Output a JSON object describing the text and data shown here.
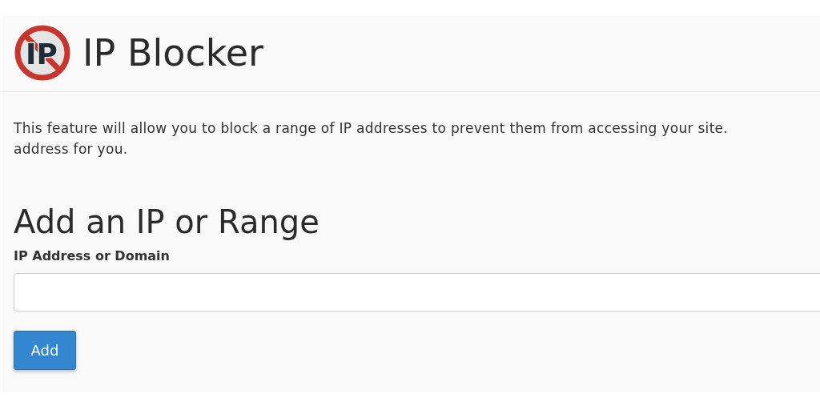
{
  "header": {
    "icon_text": "IP",
    "title": "IP Blocker"
  },
  "description": [
    "This feature will allow you to block a range of IP addresses to prevent them from accessing your site.",
    "address for you."
  ],
  "section": {
    "heading": "Add an IP or Range",
    "field_label": "IP Address or Domain",
    "button": "Add"
  }
}
